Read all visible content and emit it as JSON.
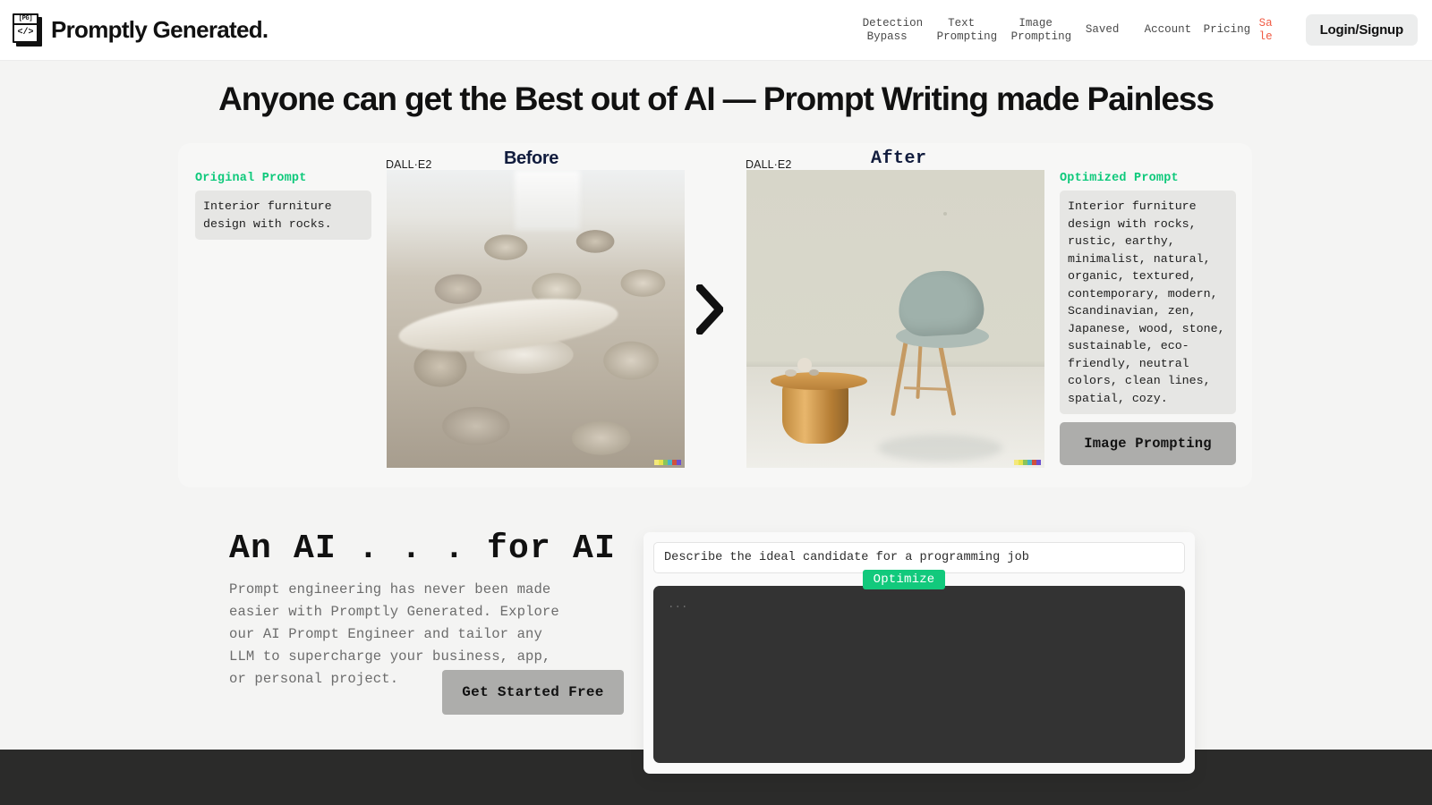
{
  "header": {
    "logo": {
      "top_text": "[PG]",
      "bottom_text": "</>",
      "icon": "code-window-icon"
    },
    "brand_name": "Promptly Generated.",
    "nav_items": [
      {
        "label": "Detection\nBypass",
        "name": "detection-bypass"
      },
      {
        "label": "Text\nPrompting",
        "name": "text-prompting"
      },
      {
        "label": "Image\nPrompting",
        "name": "image-prompting"
      },
      {
        "label": "Saved",
        "name": "saved"
      },
      {
        "label": "Account",
        "name": "account"
      },
      {
        "label": "Pricing",
        "name": "pricing"
      },
      {
        "label": "Sale",
        "name": "sale",
        "color": "#f05a43"
      }
    ],
    "login_label": "Login/Signup"
  },
  "hero": {
    "headline": "Anyone can get the Best out of AI —  Prompt Writing made Painless"
  },
  "showcase": {
    "before_label": "Before",
    "after_label": "After",
    "dalle_tag_before": "DALL·E2",
    "dalle_tag_after": "DALL·E2",
    "original_prompt_title": "Original Prompt",
    "original_prompt_text": "Interior furniture design with rocks.",
    "optimized_prompt_title": "Optimized Prompt",
    "optimized_prompt_text": "Interior furniture design with rocks, rustic, earthy, minimalist, natural, organic, textured, contemporary, modern, Scandinavian, zen, Japanese, wood, stone, sustainable, eco-friendly, neutral colors, clean lines, spatial, cozy.",
    "image_prompting_button": "Image Prompting",
    "arrow_icon": "chevron-right-icon",
    "swatch_colors": [
      "#f4e87a",
      "#e8e34c",
      "#8ac45b",
      "#47b3c9",
      "#d0503c",
      "#6b4fd0"
    ]
  },
  "lower": {
    "title": "An AI . . . for AI",
    "description": "Prompt engineering has never been made\neasier with Promptly Generated. Explore\nour AI Prompt Engineer and tailor any\nLLM to supercharge your business, app,\nor personal project.",
    "cta_label": "Get Started Free"
  },
  "demo": {
    "input_placeholder": "Describe the ideal candidate for a programming job",
    "input_value": "",
    "optimize_label": "Optimize",
    "output_placeholder": "...",
    "accent_green": "#12c97c"
  }
}
